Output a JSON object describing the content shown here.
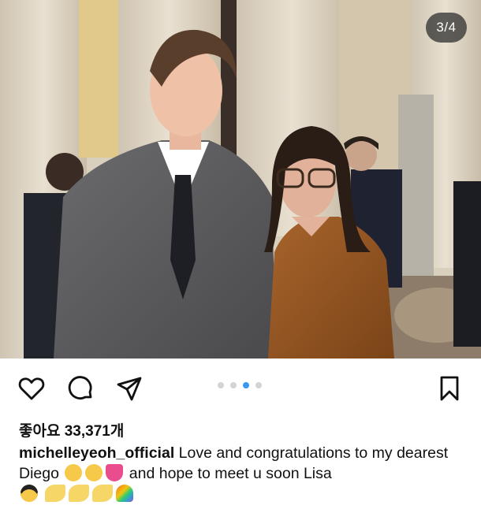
{
  "post": {
    "image_counter": "3/4",
    "carousel": {
      "count": 4,
      "active_index": 2
    },
    "likes_text": "좋아요 33,371개",
    "caption": {
      "username": "michelleyeoh_official",
      "text_part1": " Love and congratulations to my dearest Diego ",
      "text_part2": " and hope to meet u soon Lisa "
    },
    "emojis": [
      "kissing-face-emoji",
      "kissing-face-emoji",
      "sparkling-heart-emoji",
      "sunglasses-face-emoji",
      "dizzy-emoji",
      "dizzy-emoji",
      "dizzy-emoji",
      "rainbow-emoji"
    ]
  },
  "actions": {
    "like_icon": "heart-icon",
    "comment_icon": "comment-icon",
    "share_icon": "send-icon",
    "save_icon": "bookmark-icon"
  },
  "colors": {
    "accent_dot": "#3897f0",
    "inactive_dot": "#d4d4d4",
    "text": "#111111"
  }
}
